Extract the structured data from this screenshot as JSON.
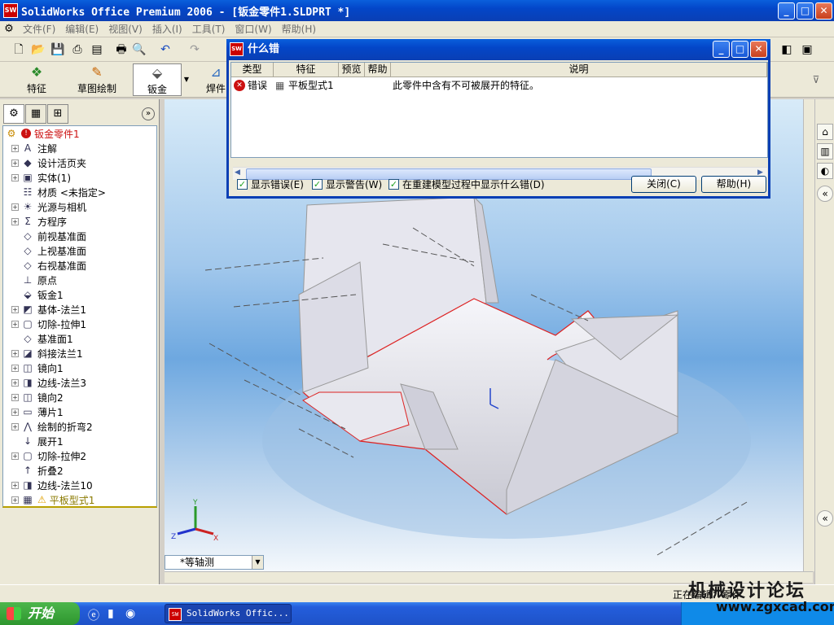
{
  "window": {
    "title": "SolidWorks Office Premium 2006 - [钣金零件1.SLDPRT *]",
    "logo": "SW"
  },
  "menu": [
    "文件(F)",
    "编辑(E)",
    "视图(V)",
    "插入(I)",
    "工具(T)",
    "窗口(W)",
    "帮助(H)"
  ],
  "command_manager": {
    "items": [
      {
        "label": "特征",
        "icon": "feature-icon"
      },
      {
        "label": "草图绘制",
        "icon": "sketch-icon"
      },
      {
        "label": "钣金",
        "icon": "sheetmetal-icon"
      },
      {
        "label": "焊件",
        "icon": "weldment-icon"
      }
    ]
  },
  "tree": {
    "root": "钣金零件1",
    "items": [
      {
        "label": "注解",
        "expand": true,
        "icon": "annotation-icon"
      },
      {
        "label": "设计活页夹",
        "expand": true,
        "icon": "binder-icon"
      },
      {
        "label": "实体(1)",
        "expand": true,
        "icon": "solid-body-icon"
      },
      {
        "label": "材质 <未指定>",
        "expand": false,
        "icon": "material-icon"
      },
      {
        "label": "光源与相机",
        "expand": true,
        "icon": "light-icon"
      },
      {
        "label": "方程序",
        "expand": true,
        "icon": "equation-icon"
      },
      {
        "label": "前视基准面",
        "expand": false,
        "icon": "plane-icon"
      },
      {
        "label": "上视基准面",
        "expand": false,
        "icon": "plane-icon"
      },
      {
        "label": "右视基准面",
        "expand": false,
        "icon": "plane-icon"
      },
      {
        "label": "原点",
        "expand": false,
        "icon": "origin-icon"
      },
      {
        "label": "钣金1",
        "expand": false,
        "icon": "sheetmetal-icon"
      },
      {
        "label": "基体-法兰1",
        "expand": true,
        "icon": "base-flange-icon"
      },
      {
        "label": "切除-拉伸1",
        "expand": true,
        "icon": "cut-extrude-icon"
      },
      {
        "label": "基准面1",
        "expand": false,
        "icon": "plane-icon"
      },
      {
        "label": "斜接法兰1",
        "expand": true,
        "icon": "miter-flange-icon"
      },
      {
        "label": "镜向1",
        "expand": true,
        "icon": "mirror-icon"
      },
      {
        "label": "边线-法兰3",
        "expand": true,
        "icon": "edge-flange-icon"
      },
      {
        "label": "镜向2",
        "expand": true,
        "icon": "mirror-icon"
      },
      {
        "label": "薄片1",
        "expand": true,
        "icon": "tab-icon"
      },
      {
        "label": "绘制的折弯2",
        "expand": true,
        "icon": "sketched-bend-icon"
      },
      {
        "label": "展开1",
        "expand": false,
        "icon": "unfold-icon"
      },
      {
        "label": "切除-拉伸2",
        "expand": true,
        "icon": "cut-extrude-icon"
      },
      {
        "label": "折叠2",
        "expand": false,
        "icon": "fold-icon"
      },
      {
        "label": "边线-法兰10",
        "expand": true,
        "icon": "edge-flange-icon"
      },
      {
        "label": "平板型式1",
        "expand": true,
        "icon": "flat-pattern-icon",
        "warning": true
      }
    ]
  },
  "view_orientation": "*等轴测",
  "status": "正在编辑：零件",
  "taskbar": {
    "start": "开始",
    "task": "SolidWorks Offic..."
  },
  "watermark": {
    "line1": "机械设计论坛",
    "line2": "www.zgxcad.com"
  },
  "dialog": {
    "title": "什么错",
    "columns": [
      "类型",
      "特征",
      "预览",
      "帮助",
      "说明"
    ],
    "row": {
      "type": "错误",
      "feature": "平板型式1",
      "description": "此零件中含有不可被展开的特征。"
    },
    "checkboxes": [
      {
        "label": "显示错误(E)",
        "checked": true
      },
      {
        "label": "显示警告(W)",
        "checked": true
      },
      {
        "label": "在重建模型过程中显示什么错(D)",
        "checked": true
      }
    ],
    "buttons": {
      "close": "关闭(C)",
      "help": "帮助(H)"
    }
  },
  "colors": {
    "title_blue": "#0a3fb4",
    "error_red": "#cc1111",
    "model_edge": "#dd2222"
  }
}
